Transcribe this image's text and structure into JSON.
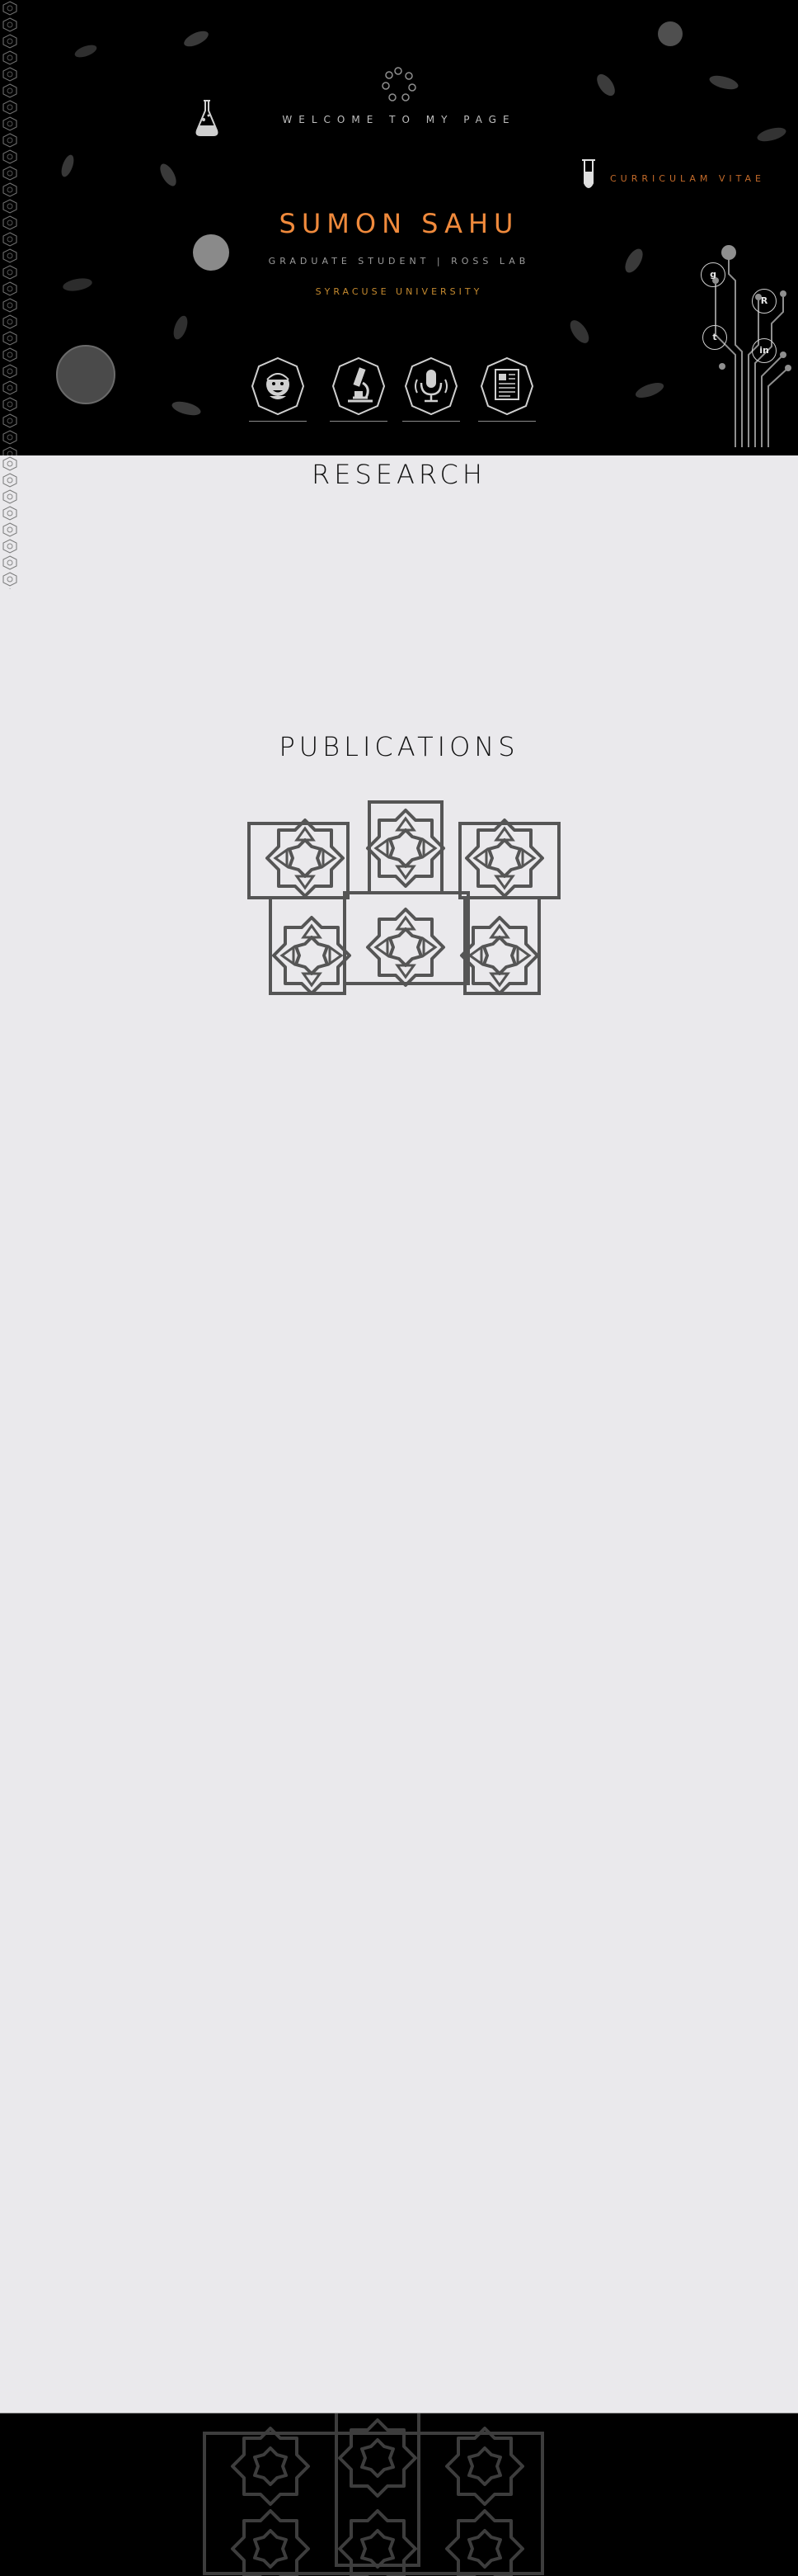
{
  "header": {
    "welcome": "WELCOME TO MY PAGE",
    "name": "SUMON SAHU",
    "role": "GRADUATE STUDENT   |   ROSS LAB",
    "university": "SYRACUSE UNIVERSITY",
    "cv_label": "CURRICULAM VITAE"
  },
  "nav_icons": [
    {
      "icon": "profile-face-icon"
    },
    {
      "icon": "microscope-icon"
    },
    {
      "icon": "microphone-icon"
    },
    {
      "icon": "document-icon"
    }
  ],
  "social": {
    "google_scholar": "g",
    "researchgate": "R",
    "twitter": "t",
    "linkedin": "in"
  },
  "sections": {
    "research_title": "RESEARCH",
    "publications_title": "PUBLICATIONS"
  },
  "colors": {
    "header_bg": "#000000",
    "page_bg": "#eae9ec",
    "accent_orange": "#f08a3c",
    "university_gold": "#c58a2f",
    "pattern_gray": "#555555"
  }
}
